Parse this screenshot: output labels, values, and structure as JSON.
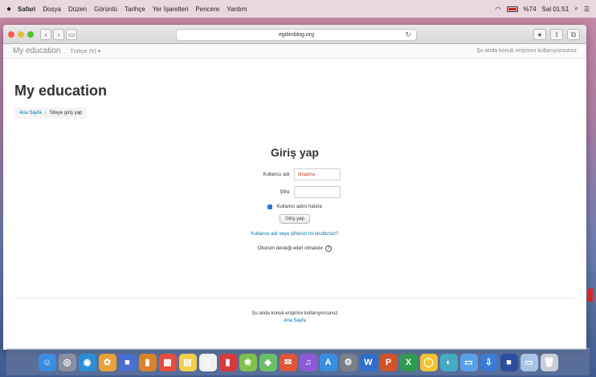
{
  "menubar": {
    "apple": "",
    "items": [
      "Safari",
      "Dosya",
      "Düzen",
      "Görüntü",
      "Tarihçe",
      "Yer İşaretleri",
      "Pencere",
      "Yardım"
    ],
    "battery": "%74",
    "clock": "Sal 01:51"
  },
  "browser": {
    "url": "egitimblog.org",
    "reload_icon": "↻"
  },
  "navbar": {
    "brand": "My education",
    "language": "Türkçe (tr) ▾",
    "guest_notice": "Şu anda konuk erişimini kullanıyorsunuz"
  },
  "header": {
    "title": "My education",
    "breadcrumb": [
      "Ana Sayfa",
      "Siteye giriş yap"
    ]
  },
  "login": {
    "heading": "Giriş yap",
    "username_label": "Kullanıcı adı",
    "username_value": "dmazha",
    "password_label": "Şifre",
    "password_value": "",
    "remember_label": "Kullanıcı adını hatırla",
    "login_button": "Giriş yap",
    "forgot_link": "Kullanıcı adı veya şifrenizi mi unuttunuz?",
    "cookies_notice": "Okurum desteği etkin olmalıdır",
    "help_icon": "?"
  },
  "footer": {
    "guest_notice": "Şu anda konuk erişimini kullanıyorsunuz",
    "home_link": "Ana Sayfa"
  },
  "colors": {
    "link": "#0070a8",
    "checkbox": "#2b7bd6"
  },
  "dock": [
    {
      "name": "finder-icon",
      "color": "#3b8de0",
      "glyph": "☺"
    },
    {
      "name": "launchpad-icon",
      "color": "#8a8fa0",
      "glyph": "◎"
    },
    {
      "name": "safari-icon",
      "color": "#2c8fd6",
      "glyph": "◉"
    },
    {
      "name": "photos-app-icon",
      "color": "#e8a23a",
      "glyph": "✿"
    },
    {
      "name": "app-icon-blue",
      "color": "#4a6fd1",
      "glyph": "■"
    },
    {
      "name": "app-icon-orange",
      "color": "#d9822b",
      "glyph": "▮"
    },
    {
      "name": "calendar-icon",
      "color": "#e94b3c",
      "glyph": "▦"
    },
    {
      "name": "notes-icon",
      "color": "#f1d04b",
      "glyph": "▤"
    },
    {
      "name": "reminders-icon",
      "color": "#f0f0f0",
      "glyph": "☰"
    },
    {
      "name": "app-icon-red",
      "color": "#d63a3a",
      "glyph": "▮"
    },
    {
      "name": "photos-icon",
      "color": "#7fc24a",
      "glyph": "❀"
    },
    {
      "name": "maps-icon",
      "color": "#6abf6a",
      "glyph": "◈"
    },
    {
      "name": "messages-icon",
      "color": "#e0553b",
      "glyph": "✉"
    },
    {
      "name": "itunes-icon",
      "color": "#8b5ad6",
      "glyph": "♫"
    },
    {
      "name": "app-store-icon",
      "color": "#3a8ee0",
      "glyph": "A"
    },
    {
      "name": "preferences-icon",
      "color": "#7b7f8a",
      "glyph": "⚙"
    },
    {
      "name": "word-icon",
      "color": "#2f6fc9",
      "glyph": "W"
    },
    {
      "name": "powerpoint-icon",
      "color": "#d2522b",
      "glyph": "P"
    },
    {
      "name": "excel-icon",
      "color": "#2e9b4f",
      "glyph": "X"
    },
    {
      "name": "app-icon-yellow",
      "color": "#f1c232",
      "glyph": "◯"
    },
    {
      "name": "app-icon-teal",
      "color": "#48a9c5",
      "glyph": "◐"
    },
    {
      "name": "folder-icon",
      "color": "#5aa0e6",
      "glyph": "▭"
    },
    {
      "name": "downloads-icon",
      "color": "#3a7bd5",
      "glyph": "⇩"
    },
    {
      "name": "app-icon-darkblue",
      "color": "#2a4fa0",
      "glyph": "■"
    },
    {
      "name": "window-icon",
      "color": "#a8c4e6",
      "glyph": "▭"
    },
    {
      "name": "trash-icon",
      "color": "#c8ccd4",
      "glyph": "🗑"
    }
  ]
}
